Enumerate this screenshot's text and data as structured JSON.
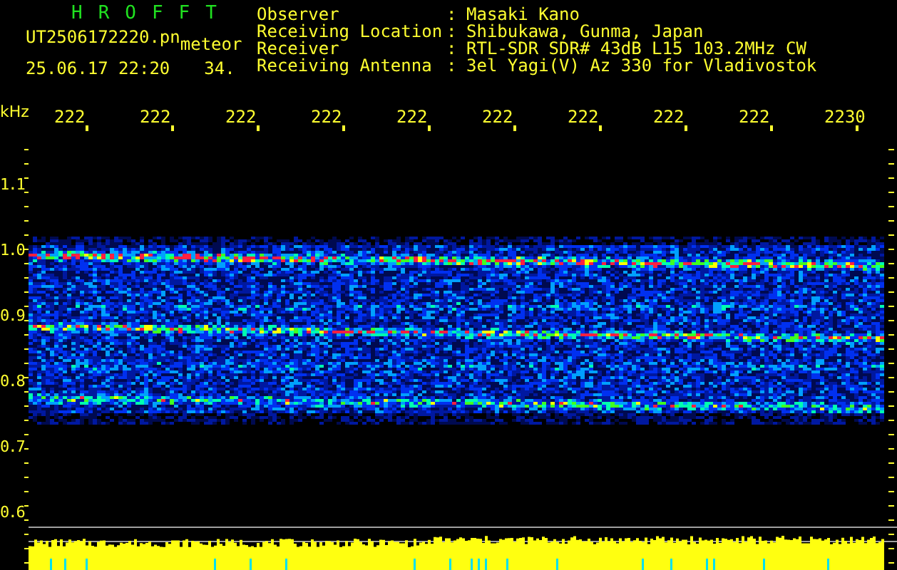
{
  "title": "HROFFT",
  "file": {
    "name": "UT2506172220.pn",
    "tag": "meteor"
  },
  "timestamp": {
    "date": "25.06.17 22:20",
    "count": "34."
  },
  "info": [
    {
      "label": "Observer",
      "separator": ":",
      "value": "Masaki Kano"
    },
    {
      "label": "Receiving Location",
      "separator": ":",
      "value": "Shibukawa, Gunma, Japan"
    },
    {
      "label": "Receiver",
      "separator": ":",
      "value": "RTL-SDR SDR# 43dB L15 103.2MHz CW"
    },
    {
      "label": "Receiving Antenna",
      "separator": ":",
      "value": "3el Yagi(V) Az 330 for Vladivostok"
    }
  ],
  "unit": "kHz",
  "time_labels": [
    "222",
    "222",
    "222",
    "222",
    "222",
    "222",
    "222",
    "222",
    "222",
    "2230"
  ],
  "frequency_labels": [
    "1.1",
    "1.0",
    "0.9",
    "0.8",
    "0.7",
    "0.6"
  ]
}
